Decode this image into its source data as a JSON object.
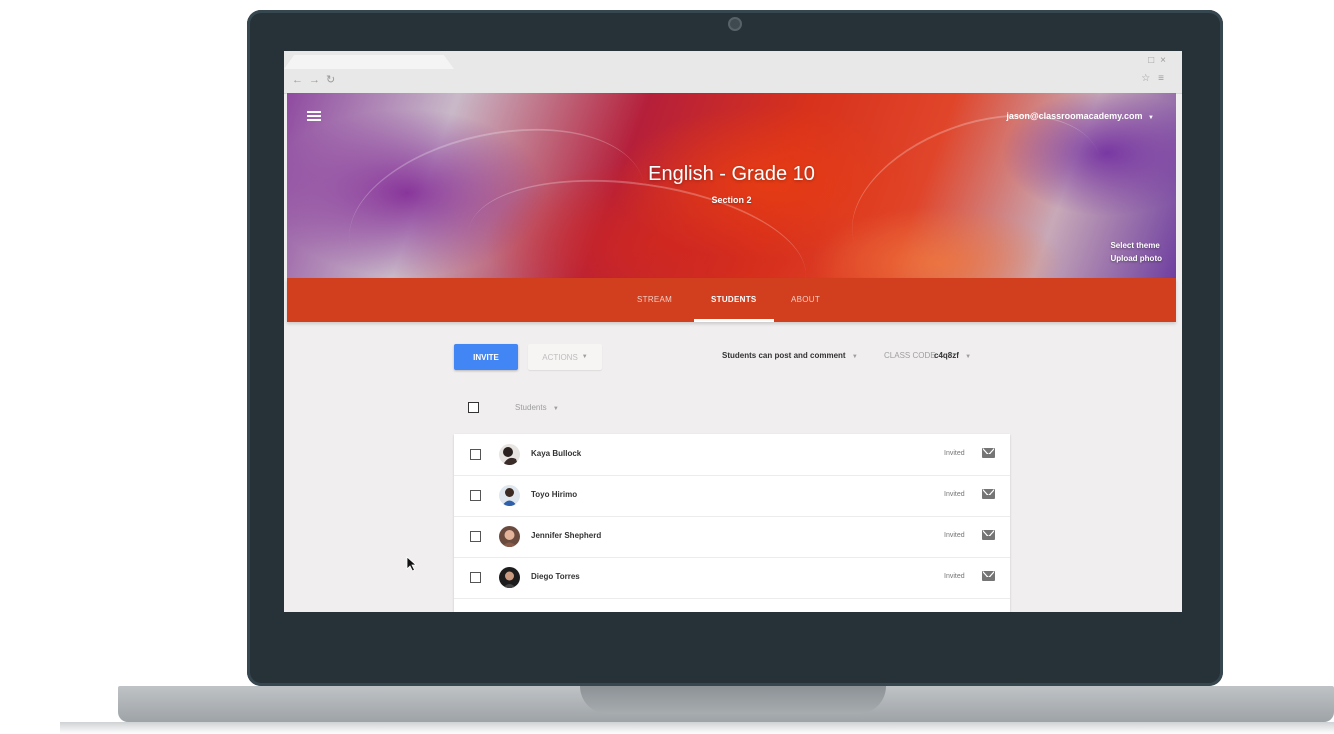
{
  "header": {
    "account": "jason@classroomacademy.com",
    "title": "English - Grade 10",
    "section": "Section 2",
    "theme_links": [
      "Select theme",
      "Upload photo"
    ]
  },
  "tabs": [
    {
      "label": "STREAM",
      "active": false
    },
    {
      "label": "STUDENTS",
      "active": true
    },
    {
      "label": "ABOUT",
      "active": false
    }
  ],
  "toolbar": {
    "invite_label": "INVITE",
    "actions_label": "ACTIONS",
    "post_setting": "Students can post and comment",
    "class_code_label": "CLASS CODE",
    "class_code_value": "c4q8zf"
  },
  "list": {
    "sort_label": "Students",
    "students": [
      {
        "name": "Kaya Bullock",
        "status": "Invited"
      },
      {
        "name": "Toyo Hirimo",
        "status": "Invited"
      },
      {
        "name": "Jennifer Shepherd",
        "status": "Invited"
      },
      {
        "name": "Diego Torres",
        "status": "Invited"
      }
    ]
  },
  "colors": {
    "accent": "#d23f1f",
    "invite": "#4285f4",
    "frame": "#263238"
  },
  "icons": [
    "menu-icon",
    "chevron-down-icon",
    "checkbox-icon",
    "mail-icon",
    "mouse-cursor-icon",
    "back-icon",
    "forward-icon",
    "reload-icon",
    "star-icon"
  ]
}
